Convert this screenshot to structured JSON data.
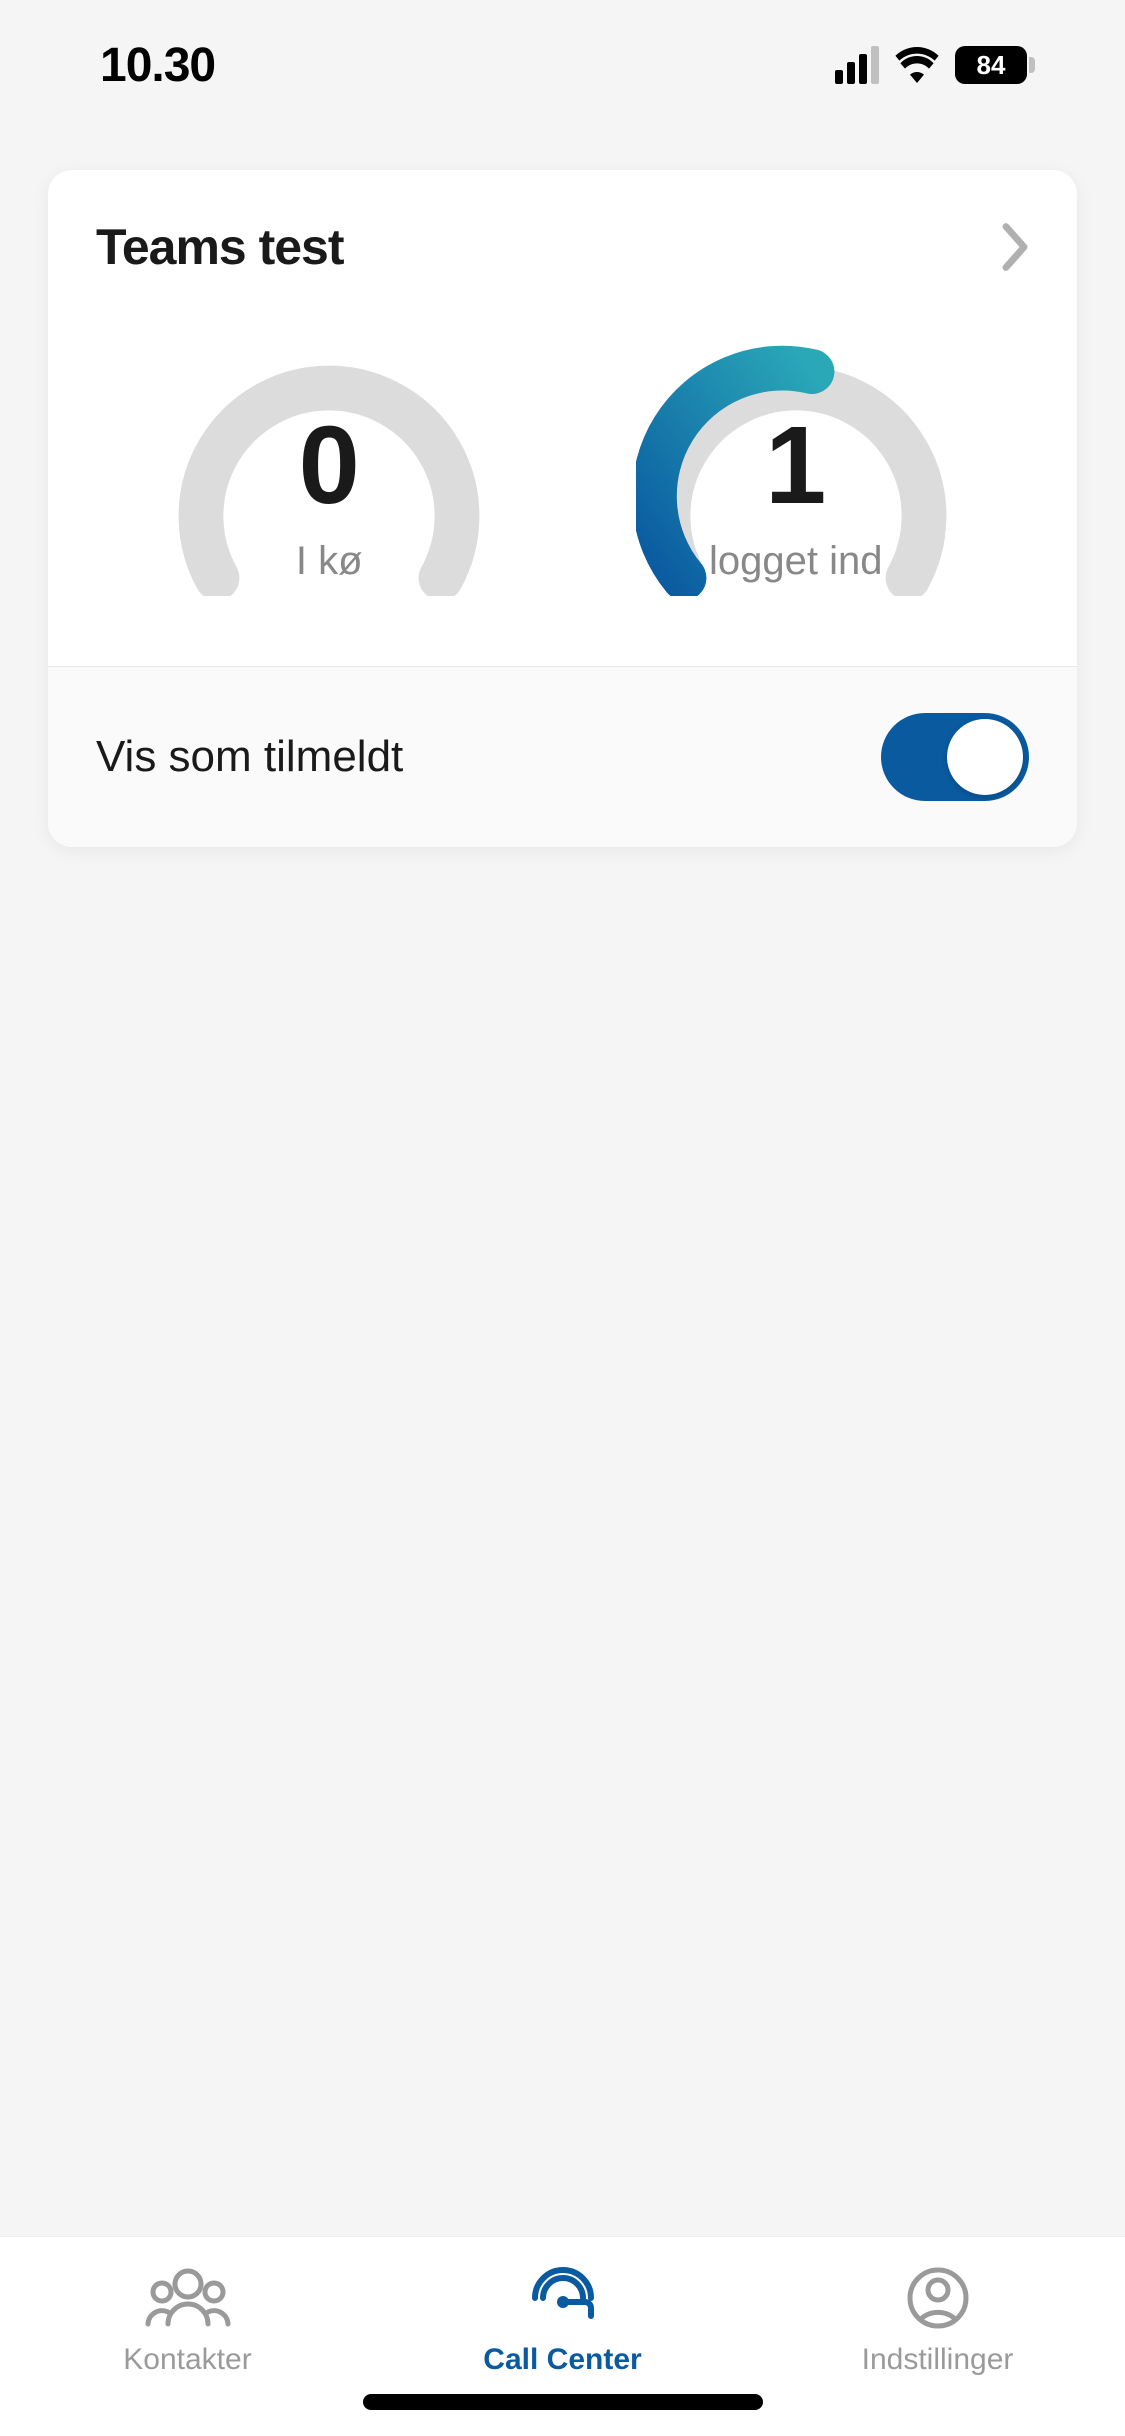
{
  "status_bar": {
    "time": "10.30",
    "battery": "84"
  },
  "card": {
    "title": "Teams test"
  },
  "gauges": {
    "queue": {
      "value": "0",
      "label": "I kø"
    },
    "logged": {
      "value": "1",
      "label": "logget ind"
    }
  },
  "toggle": {
    "label": "Vis som tilmeldt",
    "enabled": true
  },
  "tabs": {
    "contacts": "Kontakter",
    "call_center": "Call Center",
    "settings": "Indstillinger"
  }
}
